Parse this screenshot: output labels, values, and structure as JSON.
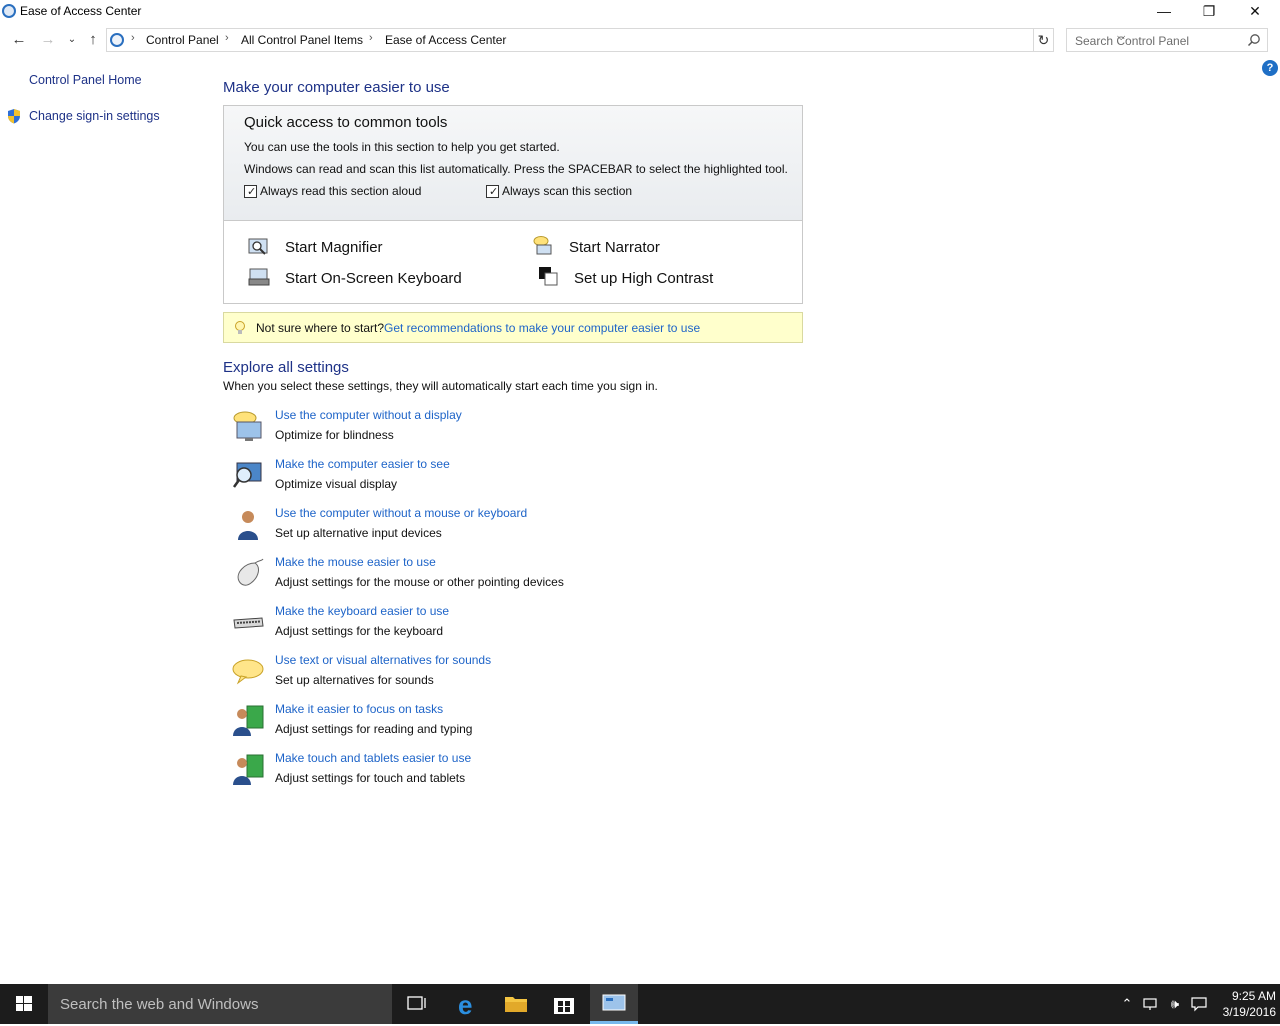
{
  "window": {
    "title": "Ease of Access Center",
    "minimize_glyph": "—",
    "restore_glyph": "❐",
    "close_glyph": "✕"
  },
  "address": {
    "crumbs": [
      "Control Panel",
      "All Control Panel Items",
      "Ease of Access Center"
    ],
    "separator": "›"
  },
  "search": {
    "placeholder": "Search Control Panel"
  },
  "sidebar": {
    "home_label": "Control Panel Home",
    "signin_label": "Change sign-in settings"
  },
  "main": {
    "heading": "Make your computer easier to use",
    "quick": {
      "title": "Quick access to common tools",
      "line1": "You can use the tools in this section to help you get started.",
      "line2": "Windows can read and scan this list automatically.  Press the SPACEBAR to select the highlighted tool.",
      "read_aloud_label": "Always read this section aloud",
      "read_aloud_checked": true,
      "scan_label": "Always scan this section",
      "scan_checked": true,
      "tools": [
        "Start Magnifier",
        "Start Narrator",
        "Start On-Screen Keyboard",
        "Set up High Contrast"
      ]
    },
    "tip": {
      "prefix": "Not sure where to start?",
      "link": "Get recommendations to make your computer easier to use"
    },
    "explore": {
      "heading": "Explore all settings",
      "subtitle": "When you select these settings, they will automatically start each time you sign in.",
      "items": [
        {
          "link": "Use the computer without a display",
          "desc": "Optimize for blindness",
          "icon": "monitor-speech-icon"
        },
        {
          "link": "Make the computer easier to see",
          "desc": "Optimize visual display",
          "icon": "monitor-magnifier-icon"
        },
        {
          "link": "Use the computer without a mouse or keyboard",
          "desc": "Set up alternative input devices",
          "icon": "person-icon"
        },
        {
          "link": "Make the mouse easier to use",
          "desc": "Adjust settings for the mouse or other pointing devices",
          "icon": "mouse-icon"
        },
        {
          "link": "Make the keyboard easier to use",
          "desc": "Adjust settings for the keyboard",
          "icon": "keyboard-icon"
        },
        {
          "link": "Use text or visual alternatives for sounds",
          "desc": "Set up alternatives for sounds",
          "icon": "speech-bubble-icon"
        },
        {
          "link": "Make it easier to focus on tasks",
          "desc": "Adjust settings for reading and typing",
          "icon": "person-screen-icon"
        },
        {
          "link": "Make touch and tablets easier to use",
          "desc": "Adjust settings for touch and tablets",
          "icon": "person-tablet-icon"
        }
      ]
    }
  },
  "taskbar": {
    "search_placeholder": "Search the web and Windows",
    "time": "9:25 AM",
    "date": "3/19/2016"
  },
  "colors": {
    "heading_blue": "#1e3287",
    "link_blue": "#1e64c8",
    "tip_background": "#ffffcc",
    "taskbar": "#1c1c1c"
  }
}
